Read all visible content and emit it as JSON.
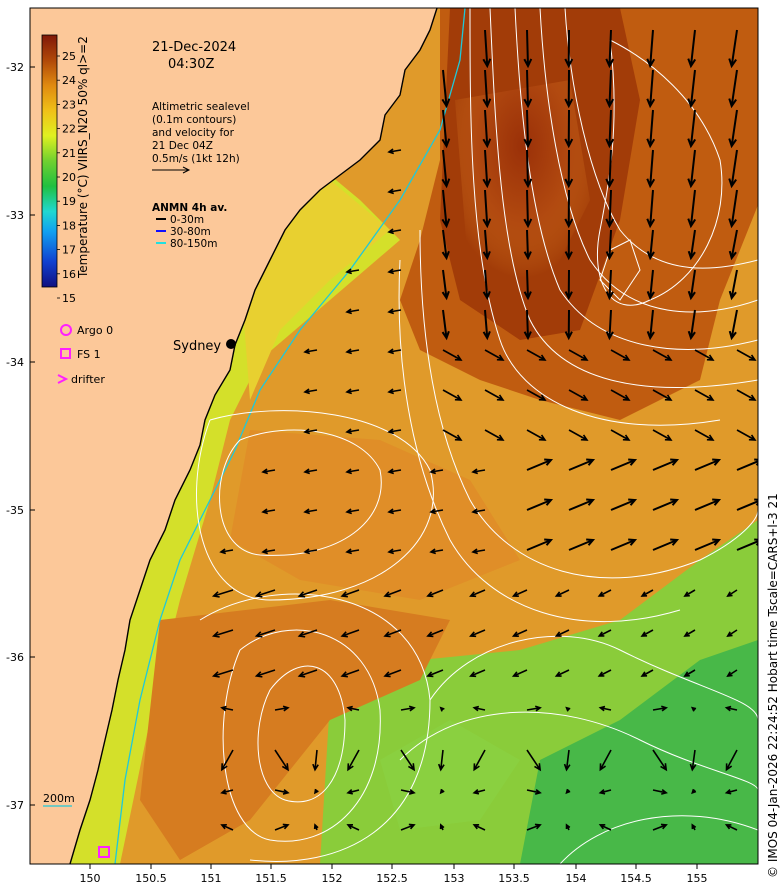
{
  "date": "21-Dec-2024",
  "time": "04:30Z",
  "altimetry_note": [
    "Altimetric sealevel",
    "(0.1m contours)",
    "and velocity for",
    "21 Dec 04Z",
    "0.5m/s (1kt 12h)"
  ],
  "anmn": {
    "title": "ANMN 4h av.",
    "items": [
      {
        "label": "0-30m",
        "color": "#000000"
      },
      {
        "label": "30-80m",
        "color": "#1010ff"
      },
      {
        "label": "80-150m",
        "color": "#20e0e0"
      }
    ]
  },
  "markers": {
    "argo": "Argo 0",
    "fs": "FS 1",
    "drifter": "drifter",
    "marker_color": "#ff20ff"
  },
  "city": "Sydney",
  "isobath_label": "200m",
  "colorbar": {
    "label": "Temperature (°C) VIIRS_N20 50% ql>=2",
    "ticks": [
      "25",
      "24",
      "23",
      "22",
      "21",
      "20",
      "19",
      "18",
      "17",
      "16",
      "15"
    ]
  },
  "axes": {
    "x_ticks": [
      "150",
      "150.5",
      "151",
      "151.5",
      "152",
      "152.5",
      "153",
      "153.5",
      "154",
      "154.5",
      "155"
    ],
    "y_ticks": [
      "-32",
      "-33",
      "-34",
      "-35",
      "-36",
      "-37"
    ]
  },
  "credit": "© IMOS 04-Jan-2026 22:24:52 Hobart time Tscale=CARS+l-3 21",
  "colors": {
    "land": "#fcc899",
    "coast": "#000000",
    "contour": "#ffffff",
    "shelf_isobath": "#20c8d8"
  }
}
